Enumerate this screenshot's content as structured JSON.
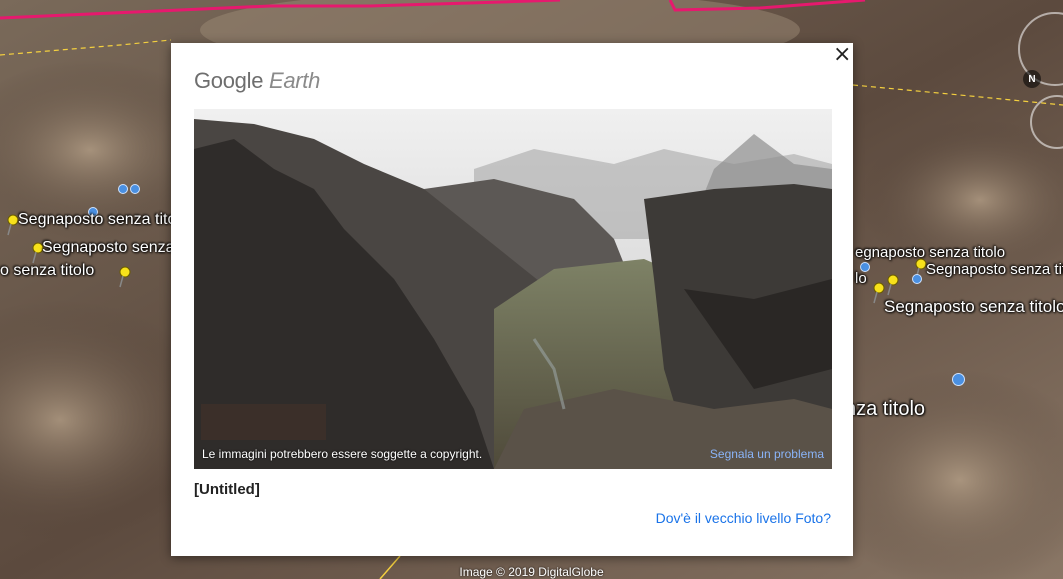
{
  "map": {
    "placemarks": [
      "Segnaposto senza titolo",
      "Segnaposto senza",
      "o senza titolo",
      "egnaposto senza titolo",
      "Segnaposto senza titolo",
      "lo",
      "Segnaposto senza titolo",
      "nza titolo"
    ],
    "attribution": "Image © 2019 DigitalGlobe",
    "compass_label": "N"
  },
  "card": {
    "logo_google": "Google",
    "logo_earth": "Earth",
    "close_label": "×",
    "copyright": "Le immagini potrebbero essere soggette a copyright.",
    "report_link": "Segnala un problema",
    "title": "[Untitled]",
    "old_layer_link": "Dov'è il vecchio livello Foto?"
  },
  "colors": {
    "link": "#1a73e8",
    "road_pink": "#e6196e",
    "road_yellow": "#f4d03f"
  }
}
